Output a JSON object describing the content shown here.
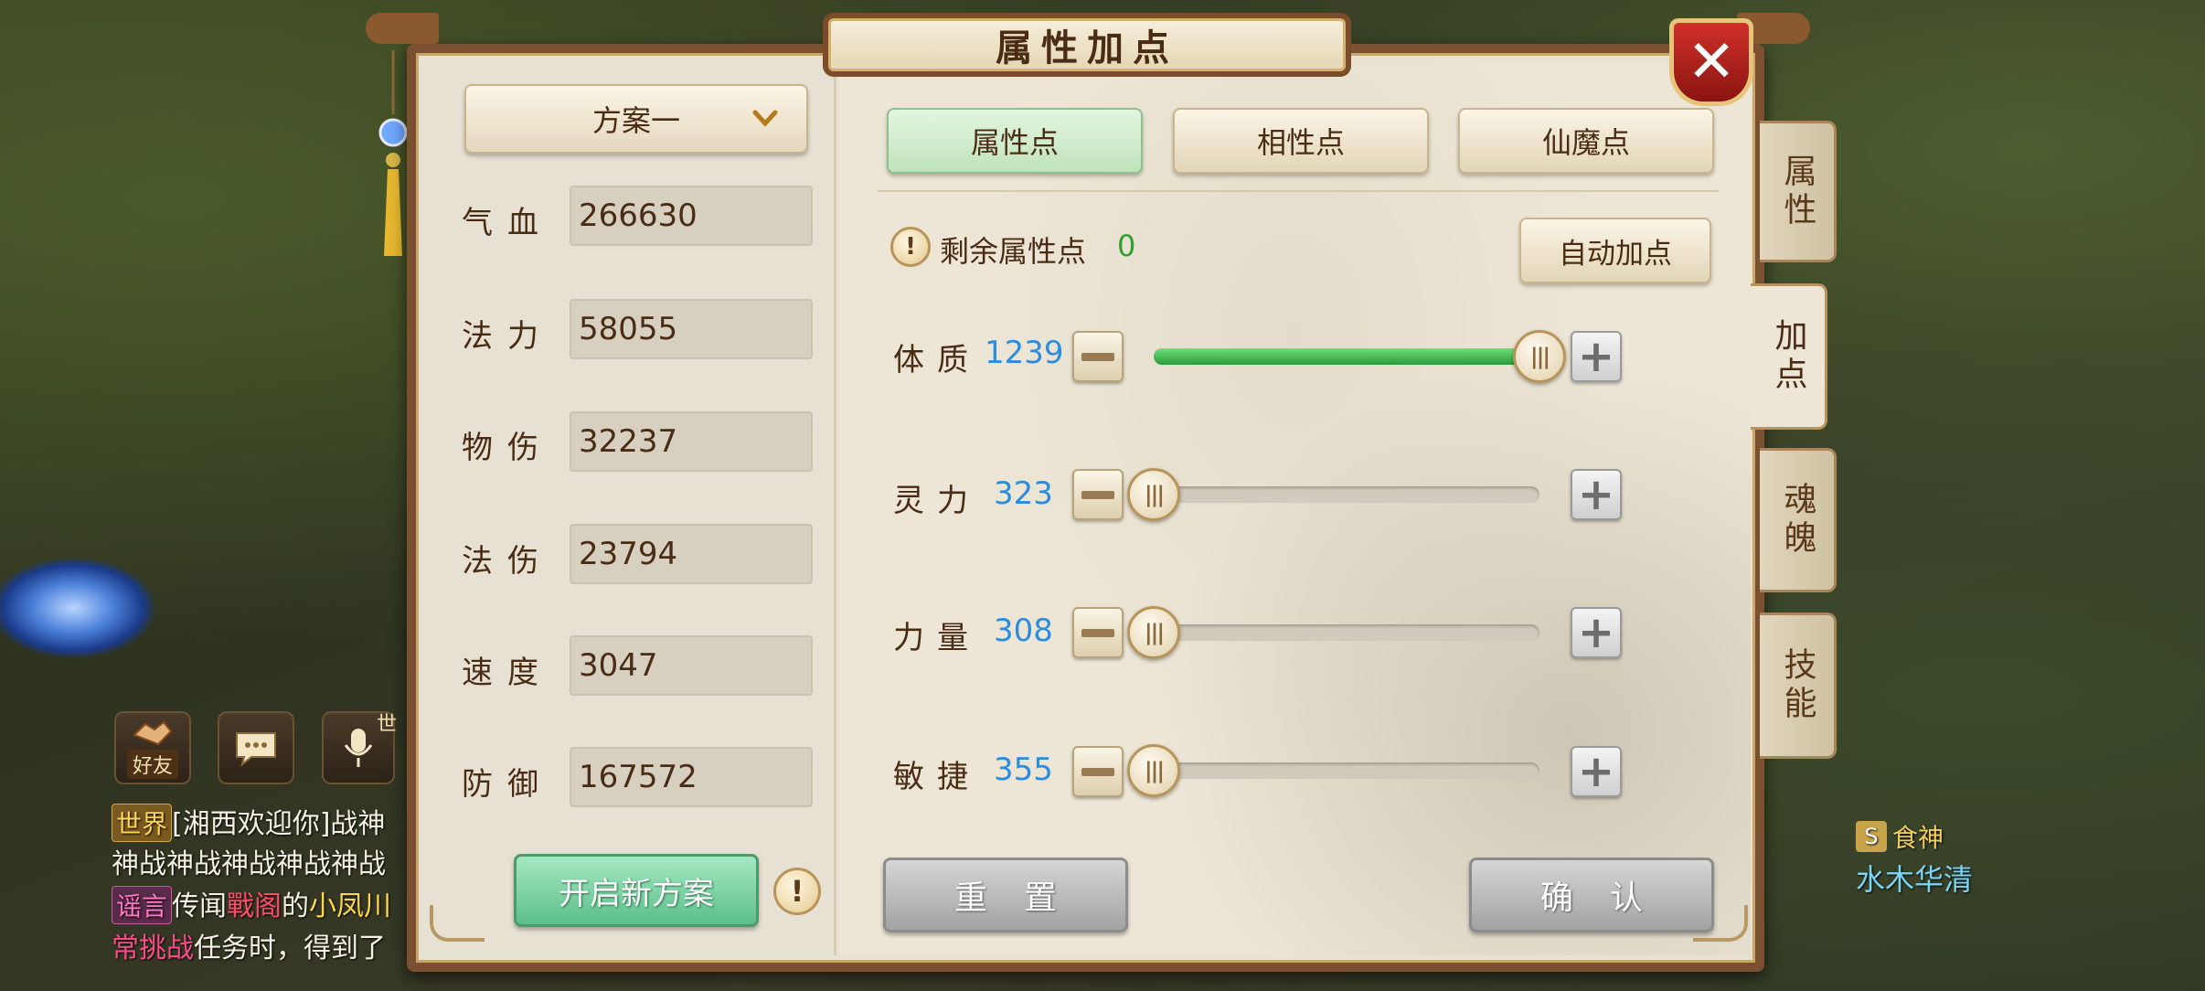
{
  "window": {
    "title": "属性加点",
    "close_icon": "close-icon"
  },
  "plan": {
    "selected": "方案一",
    "new_plan_label": "开启新方案"
  },
  "stats": [
    {
      "label": "气血",
      "value": "266630"
    },
    {
      "label": "法力",
      "value": "58055"
    },
    {
      "label": "物伤",
      "value": "32237"
    },
    {
      "label": "法伤",
      "value": "23794"
    },
    {
      "label": "速度",
      "value": "3047"
    },
    {
      "label": "防御",
      "value": "167572"
    }
  ],
  "tabs": [
    "属性点",
    "相性点",
    "仙魔点"
  ],
  "active_tab": "属性点",
  "remaining": {
    "label": "剩余属性点",
    "value": "0"
  },
  "auto_button": "自动加点",
  "attributes": [
    {
      "label": "体质",
      "value": "1239",
      "fraction": 1.0
    },
    {
      "label": "灵力",
      "value": "323",
      "fraction": 0.0
    },
    {
      "label": "力量",
      "value": "308",
      "fraction": 0.0
    },
    {
      "label": "敏捷",
      "value": "355",
      "fraction": 0.0
    }
  ],
  "actions": {
    "reset": "重置",
    "confirm": "确认"
  },
  "side_tabs": [
    "属性",
    "加点",
    "魂魄",
    "技能"
  ],
  "active_side_tab": "加点",
  "info_mark": "!",
  "chat": {
    "social": {
      "friends": "好友",
      "world_badge": "世"
    },
    "line1_tag": "世界",
    "line1_text": "[湘西欢迎你]战神",
    "line2_text": "神战神战神战神战神战",
    "line3_tag": "谣言",
    "line3_a": "传闻",
    "line3_b": "戰阁",
    "line3_c": "的",
    "line3_d": "小凤川",
    "line4_a": "常挑战",
    "line4_b": "任务时，得到了"
  },
  "npc": {
    "title": "食神",
    "name": "水木华清"
  },
  "colors": {
    "accent_green": "#2ea12e",
    "value_blue": "#2a8de0",
    "frame_brown": "#7a5030"
  }
}
